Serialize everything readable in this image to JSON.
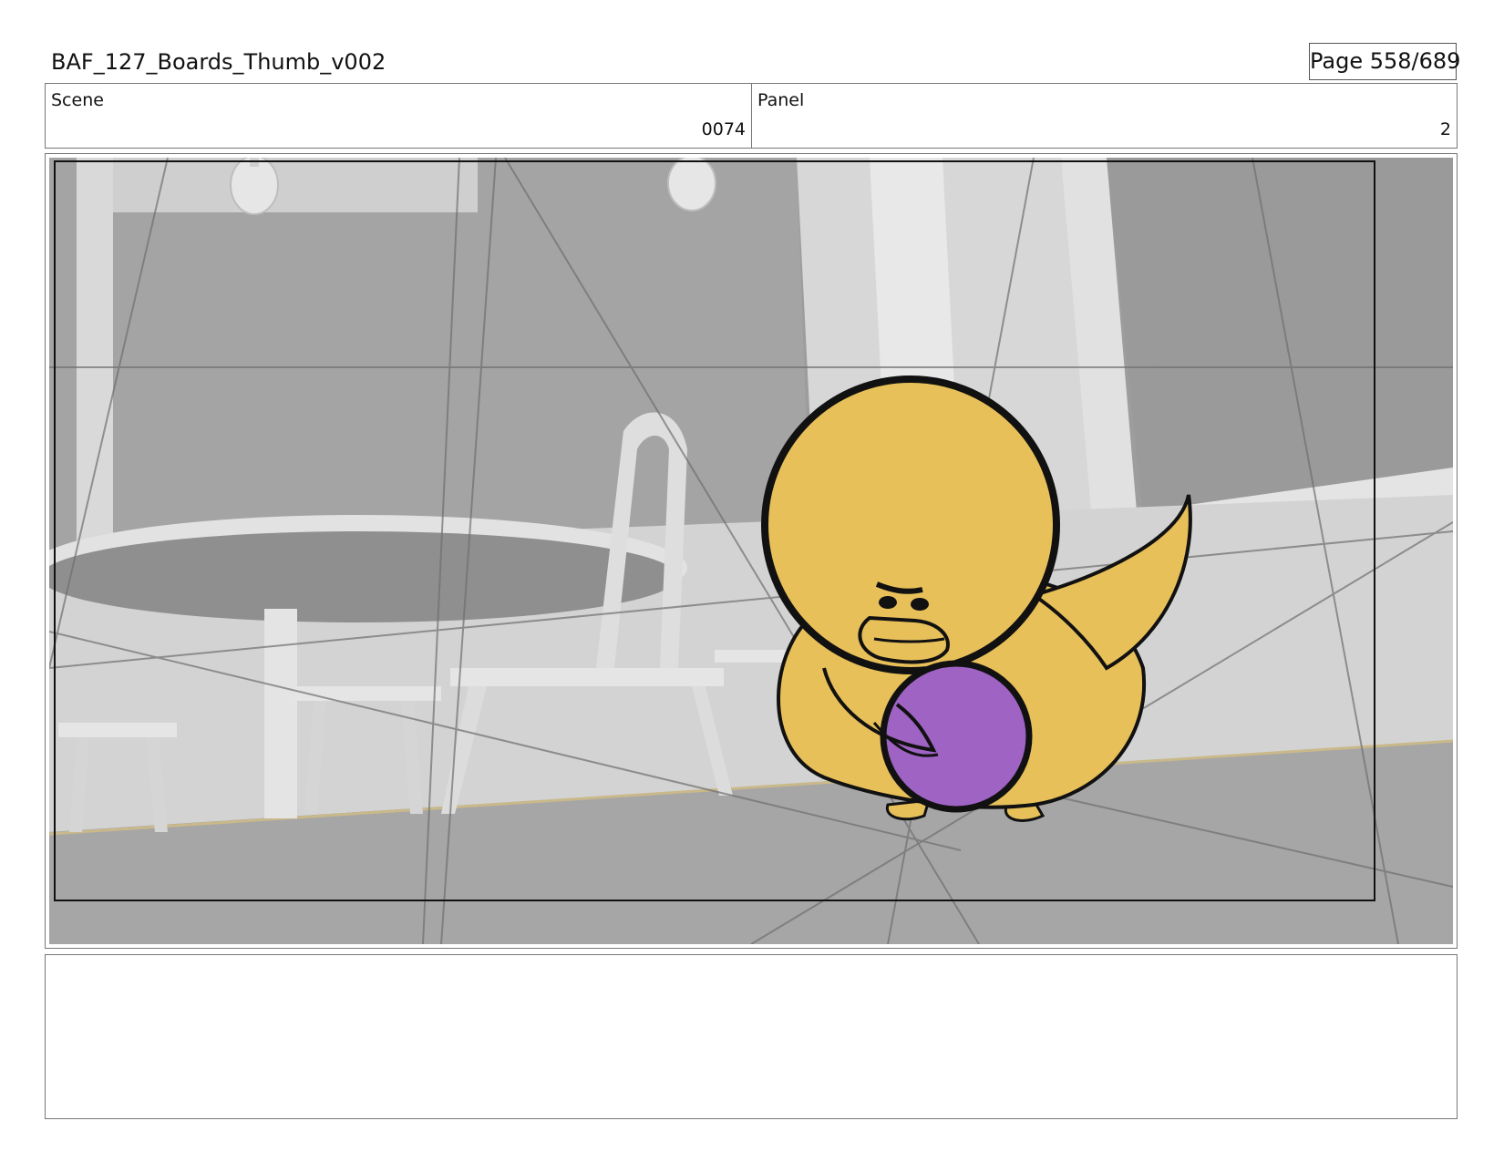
{
  "header": {
    "title": "BAF_127_Boards_Thumb_v002",
    "page": "Page 558/689"
  },
  "scene": {
    "label": "Scene",
    "value": "0074"
  },
  "panel": {
    "label": "Panel",
    "value": "2"
  },
  "artwork": {
    "description_icon": "storyboard-frame",
    "colors": {
      "character_body": "#e8c05a",
      "ball": "#9f63c4",
      "background_gray": "#9b9b9b",
      "outline": "#111111"
    }
  },
  "notes": {
    "text": ""
  }
}
